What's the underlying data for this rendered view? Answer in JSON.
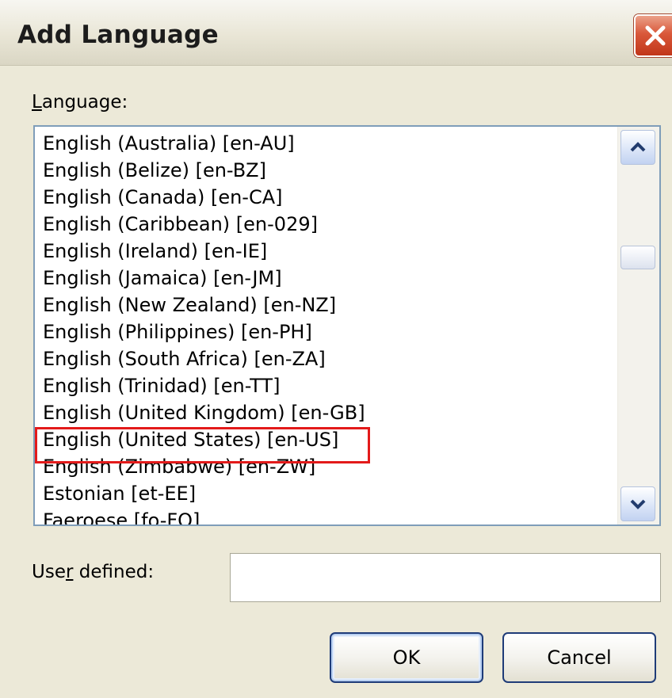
{
  "dialog": {
    "title": "Add Language"
  },
  "language_label": {
    "pre": "",
    "accel": "L",
    "post": "anguage:"
  },
  "languages": [
    "English (Australia) [en-AU]",
    "English (Belize) [en-BZ]",
    "English (Canada) [en-CA]",
    "English (Caribbean) [en-029]",
    "English (Ireland) [en-IE]",
    "English (Jamaica) [en-JM]",
    "English (New Zealand) [en-NZ]",
    "English (Philippines) [en-PH]",
    "English (South Africa) [en-ZA]",
    "English (Trinidad) [en-TT]",
    "English (United Kingdom) [en-GB]",
    "English (United States) [en-US]",
    "English (Zimbabwe) [en-ZW]",
    "Estonian [et-EE]",
    "Faeroese [fo-FO]"
  ],
  "highlighted_item": "English (United States) [en-US]",
  "user_defined_label": {
    "pre": "Use",
    "accel": "r",
    "post": " defined:"
  },
  "user_defined_value": "",
  "buttons": {
    "ok": "OK",
    "cancel": "Cancel"
  },
  "icons": {
    "close": "close-icon",
    "scroll_up": "scroll-up-arrow-icon",
    "scroll_down": "scroll-down-arrow-icon"
  },
  "colors": {
    "highlight_border": "#E31A1A",
    "close_button": "#D9583A",
    "dialog_bg": "#ECE9D8"
  }
}
